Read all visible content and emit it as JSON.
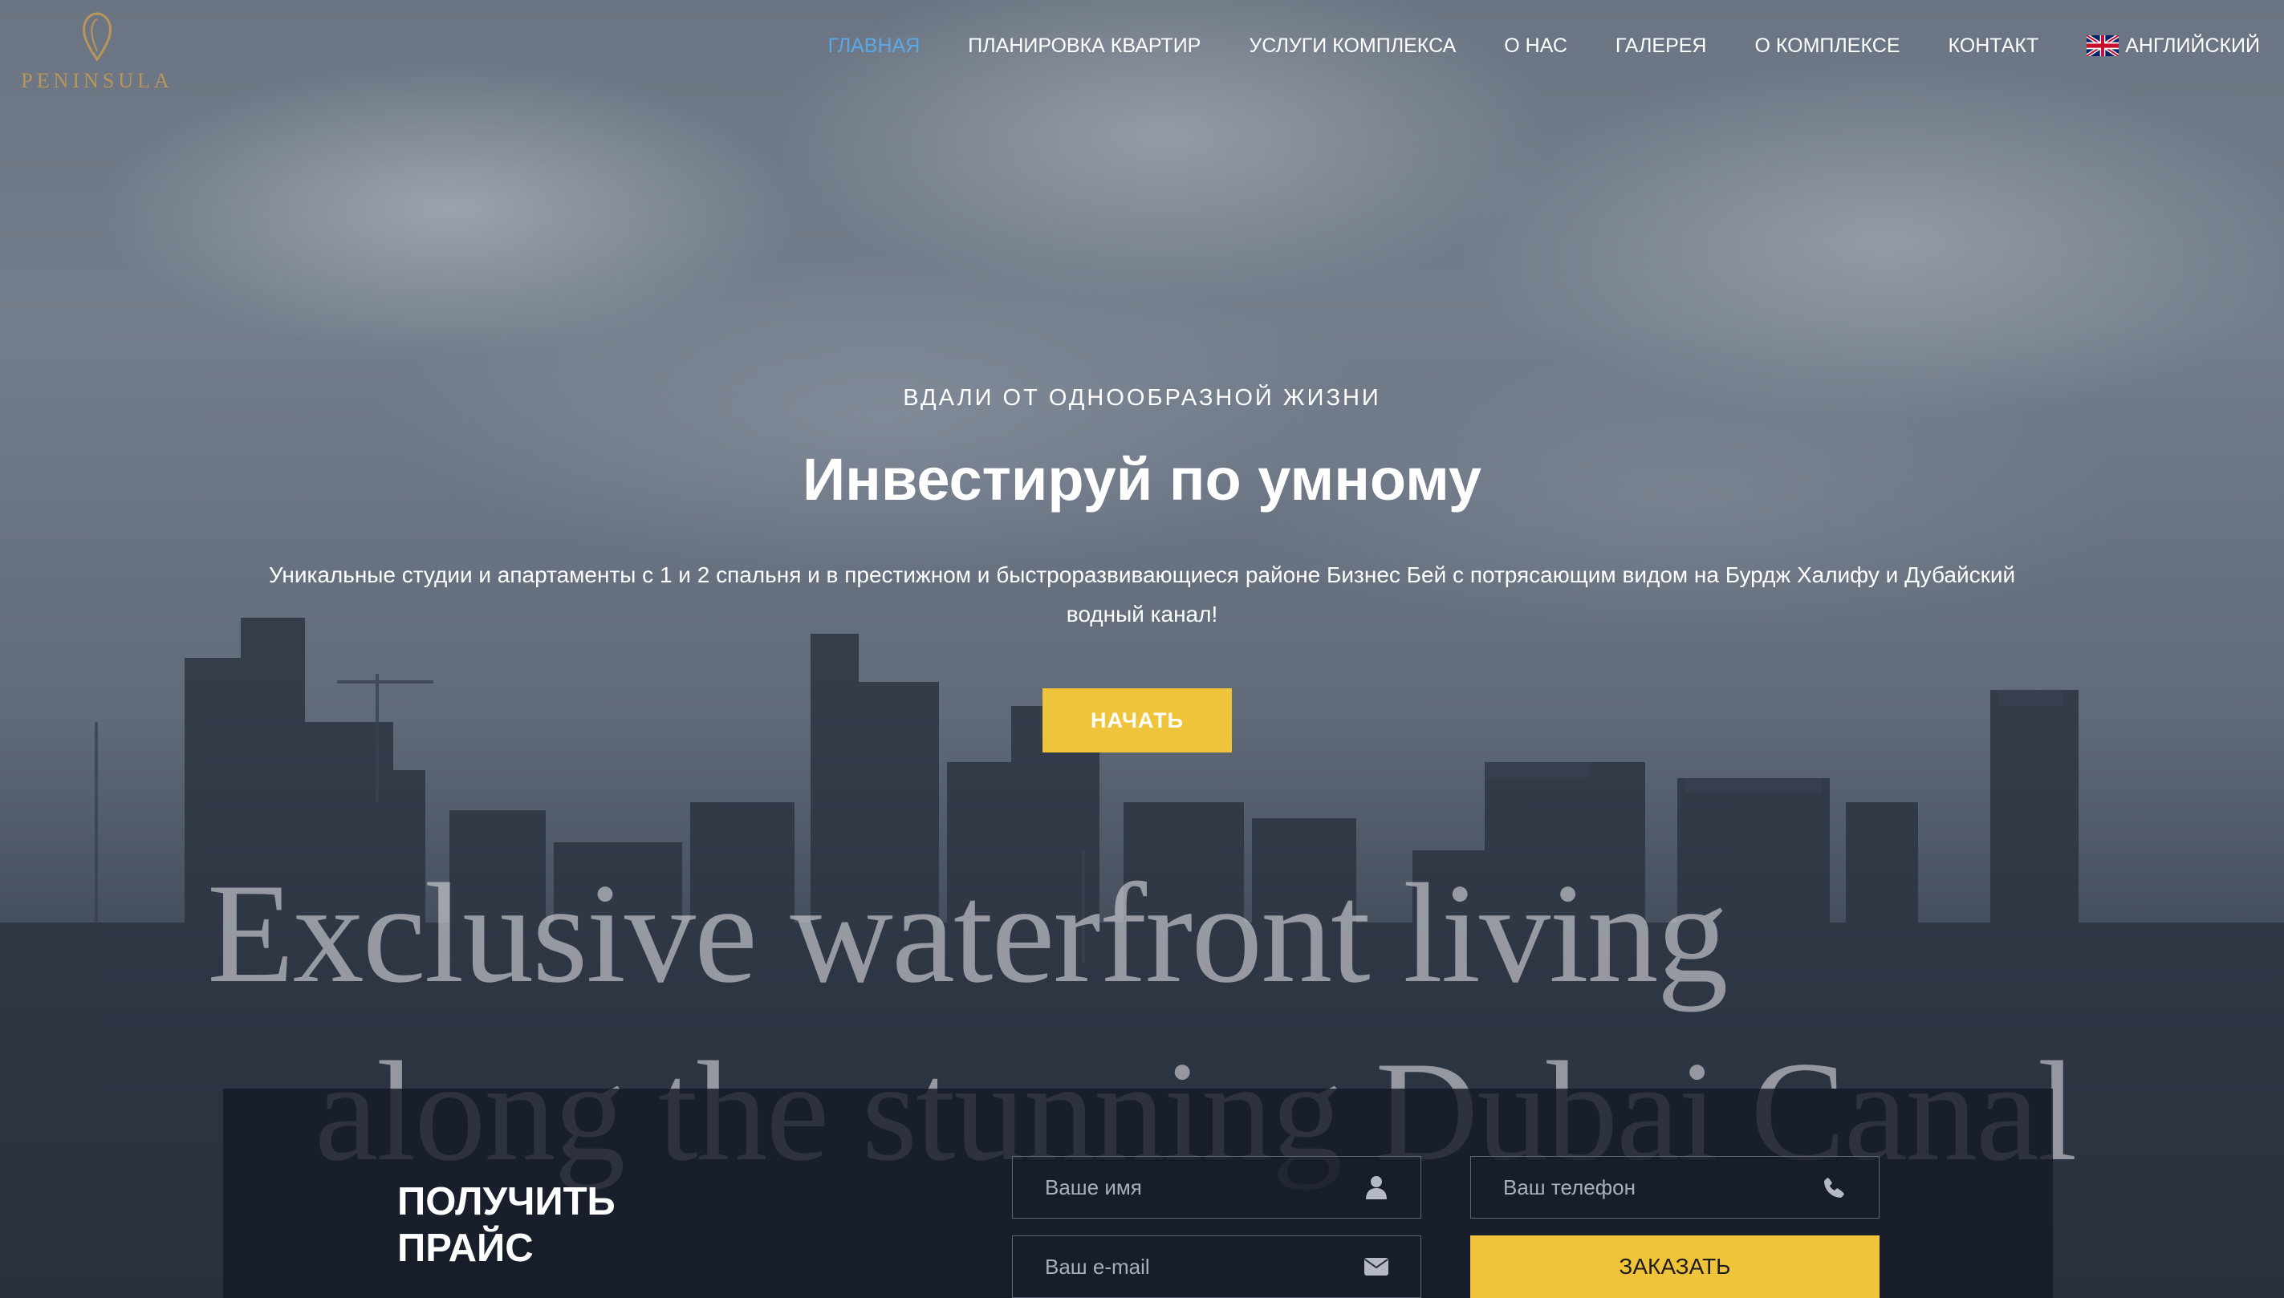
{
  "brand": {
    "logo_text": "PENINSULA",
    "logo_color": "#b8965a"
  },
  "nav": {
    "items": [
      {
        "label": "ГЛАВНАЯ",
        "active": true
      },
      {
        "label": "ПЛАНИРОВКА КВАРТИР"
      },
      {
        "label": "УСЛУГИ КОМПЛЕКСА"
      },
      {
        "label": "О НАС"
      },
      {
        "label": "ГАЛЕРЕЯ"
      },
      {
        "label": "О КОМПЛЕКСЕ"
      },
      {
        "label": "КОНТАКТ"
      }
    ],
    "language": {
      "label": "АНГЛИЙСКИЙ",
      "icon": "uk-flag-icon"
    },
    "active_color": "#5aa9e6"
  },
  "hero": {
    "kicker": "ВДАЛИ ОТ ОДНООБРАЗНОЙ ЖИЗНИ",
    "title": "Инвестируй по умному",
    "text": "Уникальные студии и апартаменты с 1 и 2 спальня и в престижном и быстроразвивающиеся районе Бизнес Бей с потрясающим видом на Бурдж Халифу и Дубайский водный канал!",
    "cta_label": "НАЧАТЬ",
    "video_caption_line1": "Exclusive waterfront living",
    "video_caption_line2": "along the stunning Dubai Canal"
  },
  "price_form": {
    "heading_line1": "ПОЛУЧИТЬ",
    "heading_line2": "ПРАЙС",
    "name_placeholder": "Ваше имя",
    "phone_placeholder": "Ваш телефон",
    "email_placeholder": "Ваш e-mail",
    "submit_label": "ЗАКАЗАТЬ",
    "icons": {
      "name": "user-icon",
      "phone": "phone-icon",
      "email": "envelope-icon"
    }
  },
  "colors": {
    "accent_yellow": "#f0c43a"
  }
}
